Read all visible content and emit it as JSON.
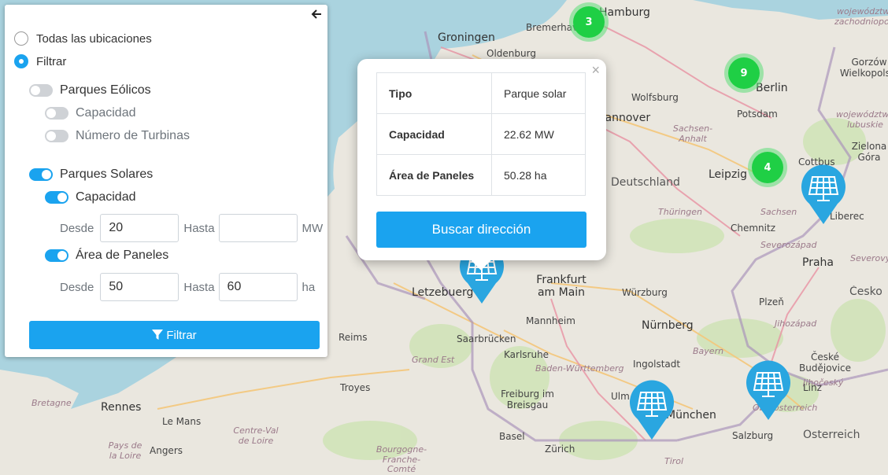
{
  "map": {
    "labels": [
      {
        "text": "Hamburg",
        "cls": "lbl-city"
      },
      {
        "text": "Bremerhaven",
        "cls": "lbl-town"
      },
      {
        "text": "Groningen",
        "cls": "lbl-city"
      },
      {
        "text": "Oldenburg",
        "cls": "lbl-town"
      },
      {
        "text": "Wolfsburg",
        "cls": "lbl-town"
      },
      {
        "text": "Hannover",
        "cls": "lbl-city"
      },
      {
        "text": "Berlin",
        "cls": "lbl-city"
      },
      {
        "text": "Potsdam",
        "cls": "lbl-town"
      },
      {
        "text": "Gorzów Wielkopolski",
        "cls": "lbl-town"
      },
      {
        "text": "województwo zachodniopomorskie",
        "cls": "lbl-region"
      },
      {
        "text": "województwo lubuskie",
        "cls": "lbl-region"
      },
      {
        "text": "Zielona Góra",
        "cls": "lbl-town"
      },
      {
        "text": "Sachsen-Anhalt",
        "cls": "lbl-region"
      },
      {
        "text": "Leipzig",
        "cls": "lbl-city"
      },
      {
        "text": "Cottbus",
        "cls": "lbl-town"
      },
      {
        "text": "Deutschland",
        "cls": "lbl-country"
      },
      {
        "text": "Sachsen",
        "cls": "lbl-region"
      },
      {
        "text": "Thüringen",
        "cls": "lbl-region"
      },
      {
        "text": "Chemnitz",
        "cls": "lbl-town"
      },
      {
        "text": "Liberec",
        "cls": "lbl-town"
      },
      {
        "text": "Severozápad",
        "cls": "lbl-region"
      },
      {
        "text": "Severovýchod",
        "cls": "lbl-region"
      },
      {
        "text": "Praha",
        "cls": "lbl-city"
      },
      {
        "text": "Česko",
        "cls": "lbl-country"
      },
      {
        "text": "Plzeň",
        "cls": "lbl-town"
      },
      {
        "text": "Jihozápad",
        "cls": "lbl-region"
      },
      {
        "text": "Frankfurt am Main",
        "cls": "lbl-city"
      },
      {
        "text": "Würzburg",
        "cls": "lbl-town"
      },
      {
        "text": "Letzebuerg",
        "cls": "lbl-city"
      },
      {
        "text": "Mannheim",
        "cls": "lbl-town"
      },
      {
        "text": "Nürnberg",
        "cls": "lbl-city"
      },
      {
        "text": "Bayern",
        "cls": "lbl-region"
      },
      {
        "text": "Saarbrücken",
        "cls": "lbl-town"
      },
      {
        "text": "Reims",
        "cls": "lbl-town"
      },
      {
        "text": "Grand Est",
        "cls": "lbl-region"
      },
      {
        "text": "Karlsruhe",
        "cls": "lbl-town"
      },
      {
        "text": "Baden-Württemberg",
        "cls": "lbl-region"
      },
      {
        "text": "Ingolstadt",
        "cls": "lbl-town"
      },
      {
        "text": "České Budějovice",
        "cls": "lbl-town"
      },
      {
        "text": "Jihočeský",
        "cls": "lbl-region"
      },
      {
        "text": "Troyes",
        "cls": "lbl-town"
      },
      {
        "text": "Freiburg im Breisgau",
        "cls": "lbl-town"
      },
      {
        "text": "Ulm",
        "cls": "lbl-town"
      },
      {
        "text": "München",
        "cls": "lbl-city"
      },
      {
        "text": "Linz",
        "cls": "lbl-town"
      },
      {
        "text": "Oberösterreich",
        "cls": "lbl-region"
      },
      {
        "text": "Salzburg",
        "cls": "lbl-town"
      },
      {
        "text": "Österreich",
        "cls": "lbl-country"
      },
      {
        "text": "Bretagne",
        "cls": "lbl-region"
      },
      {
        "text": "Rennes",
        "cls": "lbl-city"
      },
      {
        "text": "Le Mans",
        "cls": "lbl-town"
      },
      {
        "text": "Centre-Val de Loire",
        "cls": "lbl-region"
      },
      {
        "text": "Pays de la Loire",
        "cls": "lbl-region"
      },
      {
        "text": "Angers",
        "cls": "lbl-town"
      },
      {
        "text": "Basel",
        "cls": "lbl-town"
      },
      {
        "text": "Zürich",
        "cls": "lbl-town"
      },
      {
        "text": "Bourgogne-Franche-Comté",
        "cls": "lbl-region"
      },
      {
        "text": "Tirol",
        "cls": "lbl-region"
      }
    ],
    "clusters": [
      {
        "count": "3"
      },
      {
        "count": "9"
      },
      {
        "count": "4"
      }
    ],
    "solar_markers": 4,
    "colors": {
      "land": "#eae7df",
      "water": "#aad3df",
      "forest": "#cfe3b6",
      "border": "#ab95bb",
      "road": "#f4c67a",
      "motorway": "#e892a2",
      "marker": "#2aa6e0",
      "cluster": "#1fcf45",
      "accent": "#1aa3ef"
    }
  },
  "panel": {
    "collapse_icon": "arrow-left-icon",
    "all_locations_label": "Todas las ubicaciones",
    "filter_label": "Filtrar",
    "wind": {
      "label": "Parques Eólicos",
      "capacity_label": "Capacidad",
      "turbines_label": "Número de Turbinas",
      "enabled": false
    },
    "solar": {
      "label": "Parques Solares",
      "capacity_label": "Capacidad",
      "area_label": "Área de Paneles",
      "enabled": true
    },
    "from_label": "Desde",
    "to_label": "Hasta",
    "capacity": {
      "from": "20",
      "to": "",
      "unit": "MW"
    },
    "area": {
      "from": "50",
      "to": "60",
      "unit": "ha"
    },
    "filter_button": "Filtrar"
  },
  "popup": {
    "close": "×",
    "rows": [
      {
        "key": "Tipo",
        "value": "Parque solar"
      },
      {
        "key": "Capacidad",
        "value": "22.62 MW"
      },
      {
        "key": "Área de Paneles",
        "value": "50.28 ha"
      }
    ],
    "button": "Buscar dirección"
  }
}
